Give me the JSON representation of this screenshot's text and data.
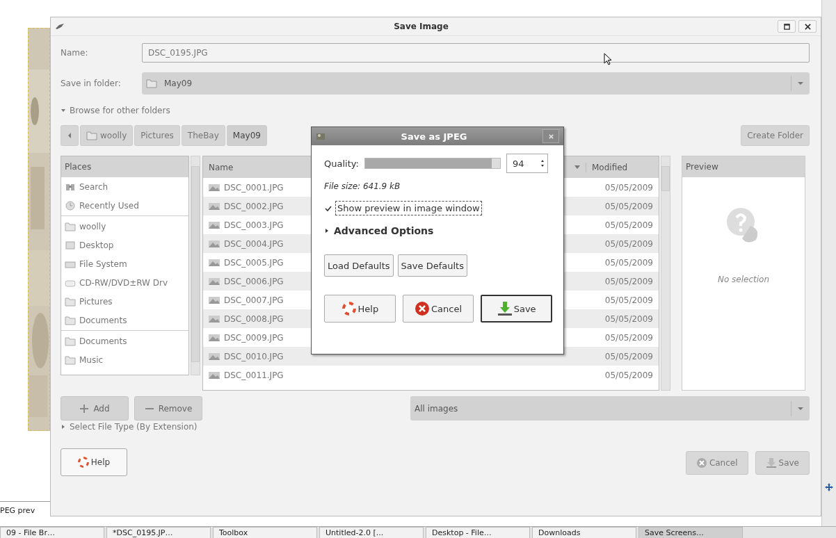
{
  "window": {
    "title": "Save Image"
  },
  "name_field": {
    "label": "Name:",
    "value": "DSC_0195.JPG"
  },
  "folder_field": {
    "label": "Save in folder:",
    "value": "May09"
  },
  "browse_expander": {
    "label": "Browse for other folders",
    "expanded": true
  },
  "path_bar": [
    {
      "label": "woolly",
      "selected": false
    },
    {
      "label": "Pictures",
      "selected": false
    },
    {
      "label": "TheBay",
      "selected": false
    },
    {
      "label": "May09",
      "selected": true
    }
  ],
  "create_folder_button": "Create Folder",
  "places": {
    "header": "Places",
    "groups": [
      [
        {
          "label": "Search",
          "kind": "search"
        },
        {
          "label": "Recently Used",
          "kind": "recent"
        }
      ],
      [
        {
          "label": "woolly",
          "kind": "folder"
        },
        {
          "label": "Desktop",
          "kind": "desktop"
        },
        {
          "label": "File System",
          "kind": "drive"
        },
        {
          "label": "CD-RW/DVD±RW Drv",
          "kind": "disc"
        },
        {
          "label": "Pictures",
          "kind": "folder"
        },
        {
          "label": "Documents",
          "kind": "folder"
        }
      ],
      [
        {
          "label": "Documents",
          "kind": "folder"
        },
        {
          "label": "Music",
          "kind": "folder"
        }
      ]
    ]
  },
  "files": {
    "columns": [
      "Name",
      "Modified"
    ],
    "rows": [
      {
        "name": "DSC_0001.JPG",
        "modified": "05/05/2009"
      },
      {
        "name": "DSC_0002.JPG",
        "modified": "05/05/2009"
      },
      {
        "name": "DSC_0003.JPG",
        "modified": "05/05/2009"
      },
      {
        "name": "DSC_0004.JPG",
        "modified": "05/05/2009"
      },
      {
        "name": "DSC_0005.JPG",
        "modified": "05/05/2009"
      },
      {
        "name": "DSC_0006.JPG",
        "modified": "05/05/2009"
      },
      {
        "name": "DSC_0007.JPG",
        "modified": "05/05/2009"
      },
      {
        "name": "DSC_0008.JPG",
        "modified": "05/05/2009"
      },
      {
        "name": "DSC_0009.JPG",
        "modified": "05/05/2009"
      },
      {
        "name": "DSC_0010.JPG",
        "modified": "05/05/2009"
      },
      {
        "name": "DSC_0011.JPG",
        "modified": "05/05/2009"
      }
    ]
  },
  "preview": {
    "header": "Preview",
    "text": "No selection"
  },
  "place_buttons": [
    {
      "label": "Add",
      "kind": "add",
      "disabled": true
    },
    {
      "label": "Remove",
      "kind": "remove",
      "disabled": true
    }
  ],
  "filter": "All images",
  "file_type_expander": {
    "label": "Select File Type (By Extension)",
    "expanded": false
  },
  "buttons": [
    {
      "label": "Help",
      "kind": "help",
      "disabled": false
    },
    {
      "label": "Cancel",
      "kind": "cancel",
      "disabled": true
    },
    {
      "label": "Save",
      "kind": "save",
      "disabled": true
    }
  ],
  "jpeg_dialog": {
    "title": "Save as JPEG",
    "quality_label": "Quality:",
    "level": 0.94,
    "quality_value": "94",
    "file_size": "File size: 641.9 kB",
    "preview_checkbox": {
      "label": "Show preview in image window",
      "checked": true
    },
    "advanced": {
      "label": "Advanced Options",
      "expanded": false
    },
    "defaults_buttons": [
      "Load Defaults",
      "Save Defaults"
    ],
    "buttons": [
      {
        "label": "Help",
        "kind": "help",
        "default": false
      },
      {
        "label": "Cancel",
        "kind": "cancel",
        "default": false
      },
      {
        "label": "Save",
        "kind": "save",
        "default": true
      }
    ]
  },
  "side_label": "PEG prev",
  "taskbar": [
    {
      "label": "09 - File Br…",
      "selected": false
    },
    {
      "label": "*DSC_0195.JP…",
      "selected": false
    },
    {
      "label": "Toolbox",
      "selected": false
    },
    {
      "label": "Untitled-2.0 [...",
      "selected": false
    },
    {
      "label": "Desktop - File…",
      "selected": false
    },
    {
      "label": "Downloads",
      "selected": false
    },
    {
      "label": "Save Screens…",
      "selected": true
    }
  ]
}
